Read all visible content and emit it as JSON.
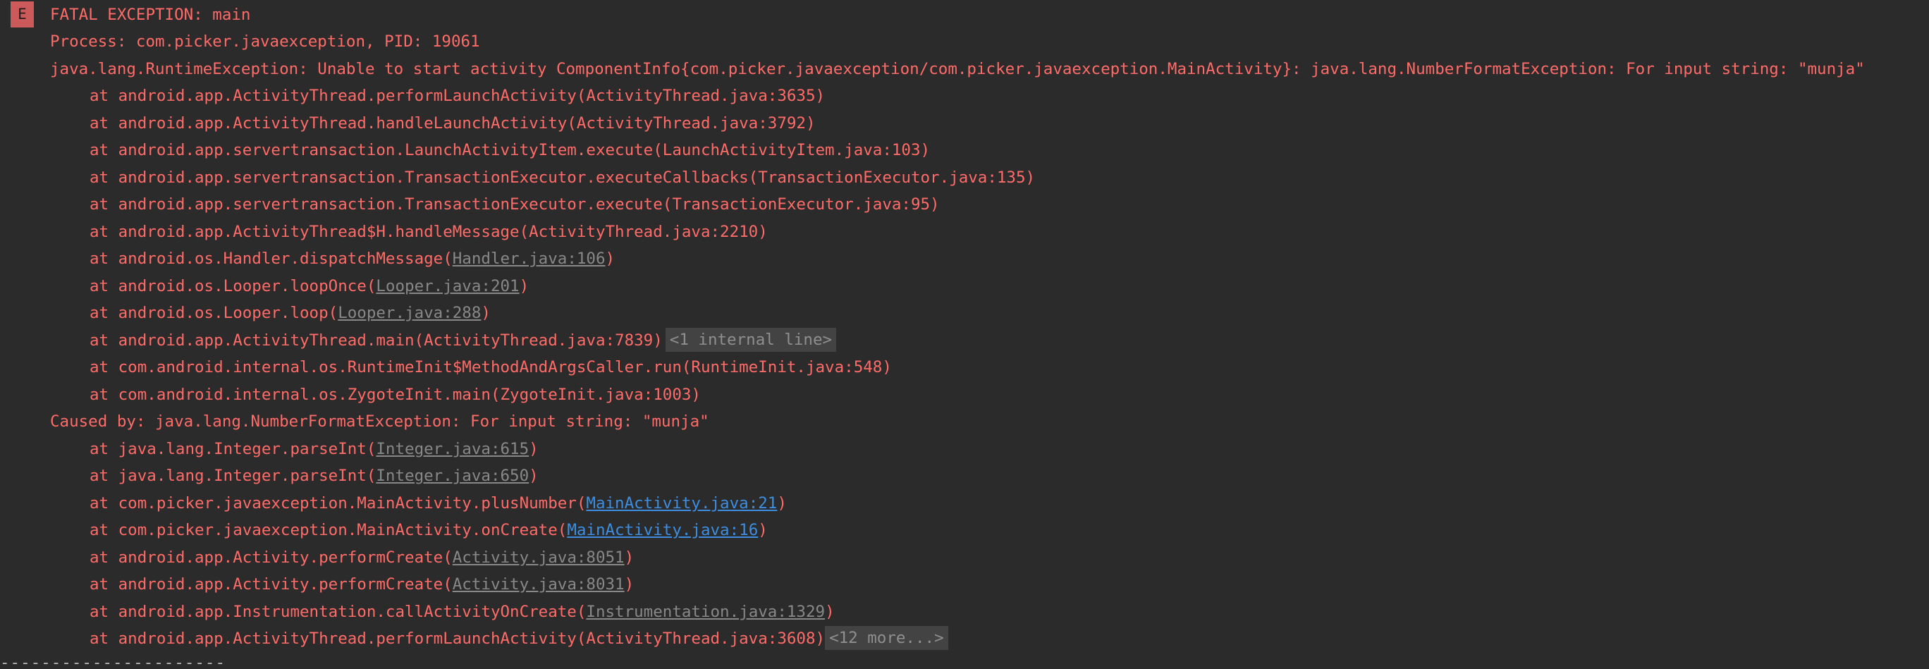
{
  "log": {
    "level_badge": "E",
    "header": "FATAL EXCEPTION: main",
    "process": "Process: com.picker.javaexception, PID: 19061",
    "exception": "java.lang.RuntimeException: Unable to start activity ComponentInfo{com.picker.javaexception/com.picker.javaexception.MainActivity}: java.lang.NumberFormatException: For input string: \"munja\"",
    "frames1": [
      {
        "prefix": "at android.app.ActivityThread.performLaunchActivity(ActivityThread.java:3635)",
        "link": "",
        "suffix": ""
      },
      {
        "prefix": "at android.app.ActivityThread.handleLaunchActivity(ActivityThread.java:3792)",
        "link": "",
        "suffix": ""
      },
      {
        "prefix": "at android.app.servertransaction.LaunchActivityItem.execute(LaunchActivityItem.java:103)",
        "link": "",
        "suffix": ""
      },
      {
        "prefix": "at android.app.servertransaction.TransactionExecutor.executeCallbacks(TransactionExecutor.java:135)",
        "link": "",
        "suffix": ""
      },
      {
        "prefix": "at android.app.servertransaction.TransactionExecutor.execute(TransactionExecutor.java:95)",
        "link": "",
        "suffix": ""
      },
      {
        "prefix": "at android.app.ActivityThread$H.handleMessage(ActivityThread.java:2210)",
        "link": "",
        "suffix": ""
      },
      {
        "prefix": "at android.os.Handler.dispatchMessage(",
        "link": "Handler.java:106",
        "suffix": ")"
      },
      {
        "prefix": "at android.os.Looper.loopOnce(",
        "link": "Looper.java:201",
        "suffix": ")"
      },
      {
        "prefix": "at android.os.Looper.loop(",
        "link": "Looper.java:288",
        "suffix": ")"
      },
      {
        "prefix": "at android.app.ActivityThread.main(ActivityThread.java:7839)",
        "link": "",
        "suffix": "",
        "fold": "<1 internal line>"
      },
      {
        "prefix": "at com.android.internal.os.RuntimeInit$MethodAndArgsCaller.run(RuntimeInit.java:548)",
        "link": "",
        "suffix": ""
      },
      {
        "prefix": "at com.android.internal.os.ZygoteInit.main(ZygoteInit.java:1003)",
        "link": "",
        "suffix": ""
      }
    ],
    "caused_by": "Caused by: java.lang.NumberFormatException: For input string: \"munja\"",
    "frames2": [
      {
        "prefix": "at java.lang.Integer.parseInt(",
        "link": "Integer.java:615",
        "suffix": ")"
      },
      {
        "prefix": "at java.lang.Integer.parseInt(",
        "link": "Integer.java:650",
        "suffix": ")"
      },
      {
        "prefix": "at com.picker.javaexception.MainActivity.plusNumber(",
        "link": "MainActivity.java:21",
        "suffix": ")",
        "source": true
      },
      {
        "prefix": "at com.picker.javaexception.MainActivity.onCreate(",
        "link": "MainActivity.java:16",
        "suffix": ")",
        "source": true
      },
      {
        "prefix": "at android.app.Activity.performCreate(",
        "link": "Activity.java:8051",
        "suffix": ")"
      },
      {
        "prefix": "at android.app.Activity.performCreate(",
        "link": "Activity.java:8031",
        "suffix": ")"
      },
      {
        "prefix": "at android.app.Instrumentation.callActivityOnCreate(",
        "link": "Instrumentation.java:1329",
        "suffix": ")"
      },
      {
        "prefix": "at android.app.ActivityThread.performLaunchActivity(ActivityThread.java:3608)",
        "link": "",
        "suffix": "",
        "fold": "<12 more...>",
        "fold_tight": true
      }
    ],
    "separator": "----------------------"
  }
}
